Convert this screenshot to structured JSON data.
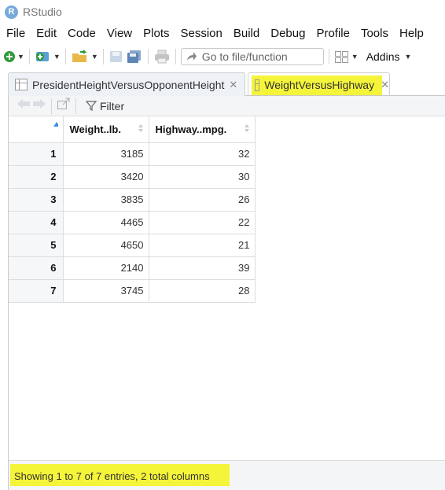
{
  "window": {
    "title": "RStudio",
    "logo_letter": "R"
  },
  "menu": [
    "File",
    "Edit",
    "Code",
    "View",
    "Plots",
    "Session",
    "Build",
    "Debug",
    "Profile",
    "Tools",
    "Help"
  ],
  "toolbar": {
    "goto_placeholder": "Go to file/function",
    "addins_label": "Addins"
  },
  "tabs": [
    {
      "label": "PresidentHeightVersusOpponentHeight",
      "active": false
    },
    {
      "label": "WeightVersusHighway",
      "active": true,
      "highlighted": true
    }
  ],
  "viewer": {
    "filter_label": "Filter",
    "columns": [
      "Weight..lb.",
      "Highway..mpg."
    ],
    "rows": [
      {
        "row": "1",
        "weight": "3185",
        "highway": "32"
      },
      {
        "row": "2",
        "weight": "3420",
        "highway": "30"
      },
      {
        "row": "3",
        "weight": "3835",
        "highway": "26"
      },
      {
        "row": "4",
        "weight": "4465",
        "highway": "22"
      },
      {
        "row": "5",
        "weight": "4650",
        "highway": "21"
      },
      {
        "row": "6",
        "weight": "2140",
        "highway": "39"
      },
      {
        "row": "7",
        "weight": "3745",
        "highway": "28"
      }
    ],
    "status": "Showing 1 to 7 of 7 entries, 2 total columns"
  },
  "colors": {
    "highlight": "#f4f43a",
    "accent": "#75aadb",
    "sort_active": "#3a8ee6"
  }
}
